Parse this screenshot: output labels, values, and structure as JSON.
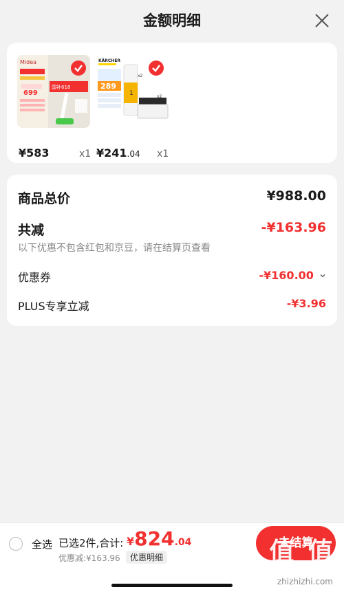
{
  "header": {
    "title": "金额明细"
  },
  "products": [
    {
      "price_int": "¥583",
      "price_dec": "",
      "qty": "x1",
      "image_text": [
        "Midea",
        "国补618",
        "699"
      ]
    },
    {
      "price_int": "¥241",
      "price_dec": ".04",
      "qty": "x1",
      "image_text": [
        "KÄRCHER",
        "289",
        "x2",
        "x2"
      ]
    }
  ],
  "summary": {
    "total_label": "商品总价",
    "total_value": "¥988.00",
    "reduce_label": "共减",
    "reduce_value": "-¥163.96",
    "note": "以下优惠不包含红包和京豆，请在结算页查看",
    "coupon_label": "优惠券",
    "coupon_value": "-¥160.00",
    "plus_label": "PLUS专享立减",
    "plus_value": "-¥3.96"
  },
  "bottom": {
    "select_all": "全选",
    "selected_text": "已选2件,合计:",
    "total_cur": "¥",
    "total_int": "824",
    "total_dec": ".04",
    "discount_line": "优惠减:¥163.96",
    "detail_tag": "优惠明细",
    "checkout": "去结算",
    "watermark": "值 值 值",
    "watermark_url": "zhizhizhi.com"
  },
  "colors": {
    "accent": "#f23030",
    "background": "#f2f2f2"
  }
}
